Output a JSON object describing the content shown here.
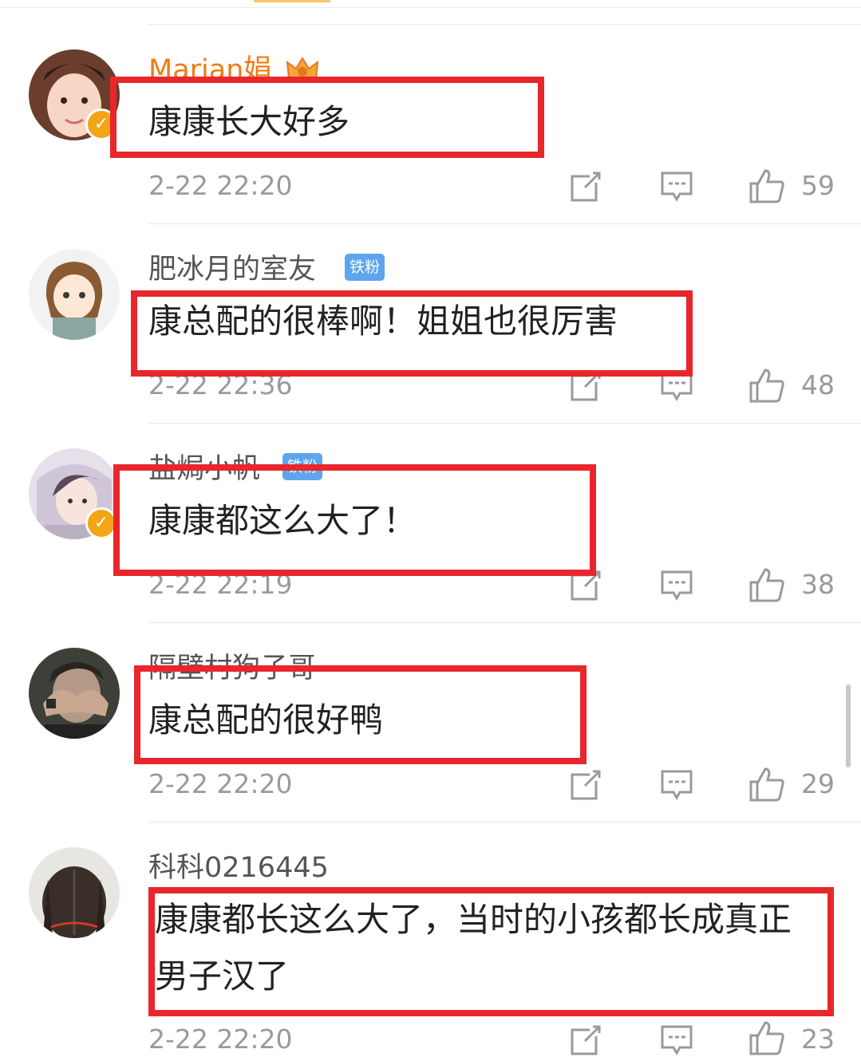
{
  "comments": [
    {
      "username": "Marian娟",
      "badge": "",
      "text": "康康长大好多",
      "text_line2": "",
      "time": "2-22 22:20",
      "likes": "59"
    },
    {
      "username": "肥冰月的室友",
      "badge": "铁粉",
      "text": "康总配的很棒啊！姐姐也很厉害",
      "text_line2": "",
      "time": "2-22 22:36",
      "likes": "48"
    },
    {
      "username": "盐焗小帆",
      "badge": "铁粉",
      "text": "康康都这么大了！",
      "text_line2": "",
      "time": "2-22 22:19",
      "likes": "38"
    },
    {
      "username": "隔壁村狗子哥",
      "badge": "",
      "text": "康总配的很好鸭",
      "text_line2": "",
      "time": "2-22 22:20",
      "likes": "29"
    },
    {
      "username": "科科0216445",
      "badge": "",
      "text": "康康都长这么大了，当时的小孩都长成真正",
      "text_line2": "男子汉了",
      "time": "2-22 22:20",
      "likes": "23"
    }
  ],
  "icons": {
    "share": "share-icon",
    "comment": "comment-icon",
    "like": "thumbs-up-icon",
    "verified": "verified-badge-icon",
    "crown": "crown-icon"
  },
  "colors": {
    "highlight_box": "#e8262b",
    "username_vip": "#f07c12",
    "badge_fan": "#5ea4ee",
    "verified": "#f4a516",
    "meta": "#9a9a9a"
  }
}
